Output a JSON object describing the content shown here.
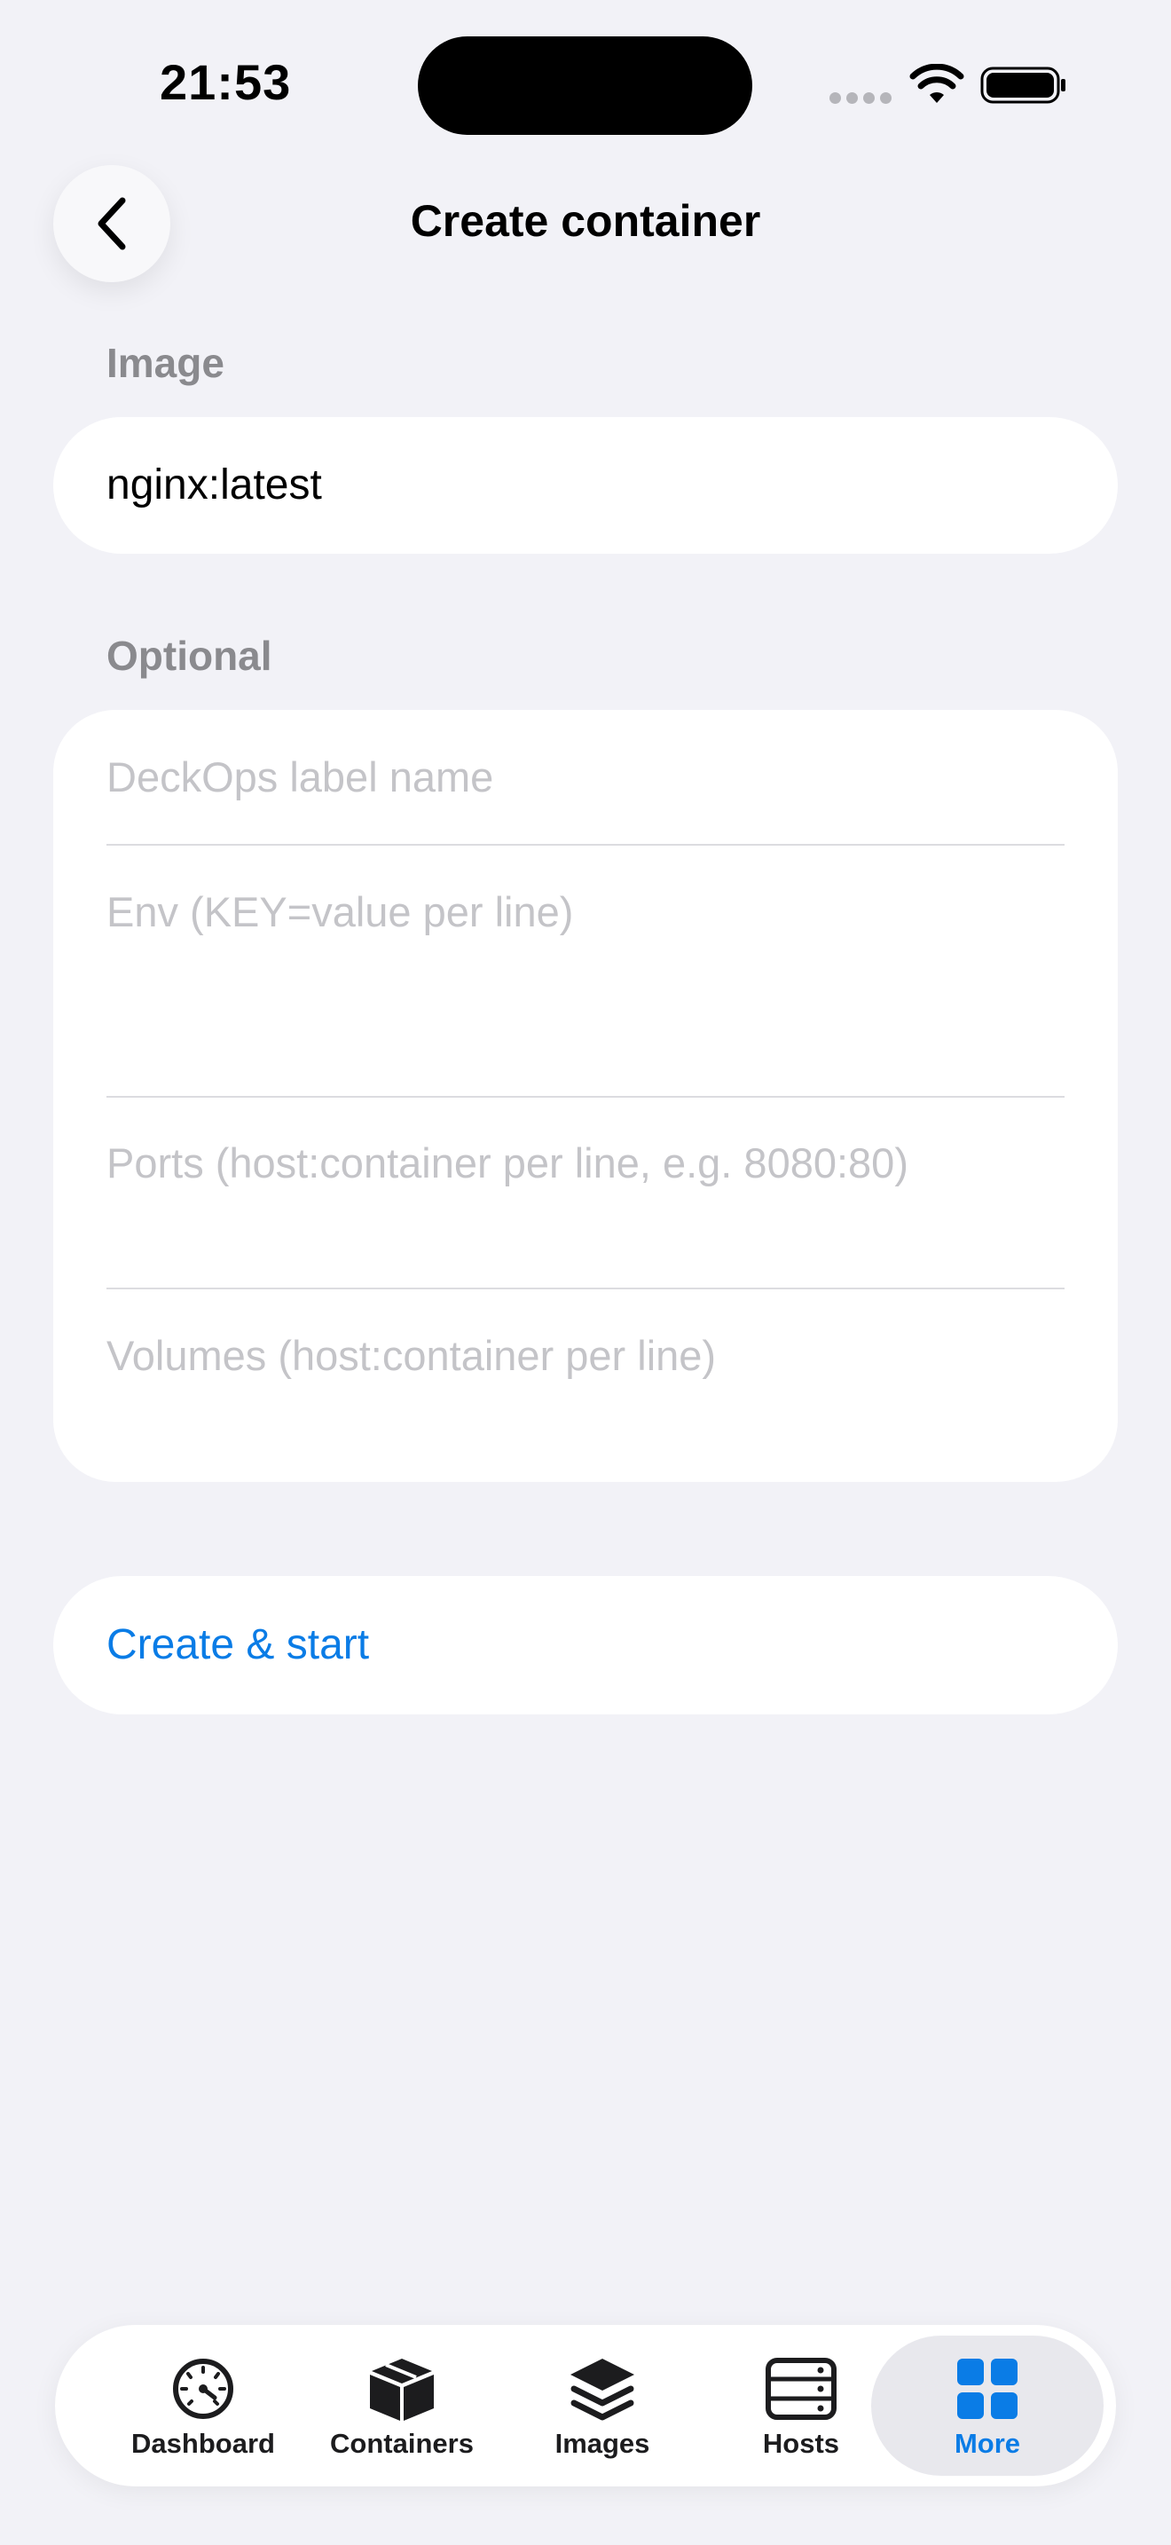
{
  "status_bar": {
    "time": "21:53"
  },
  "nav": {
    "title": "Create container",
    "back_icon": "chevron-left-icon"
  },
  "image_section": {
    "header": "Image",
    "value": "nginx:latest"
  },
  "optional_section": {
    "header": "Optional",
    "label_placeholder": "DeckOps label name",
    "env_placeholder": "Env (KEY=value per line)",
    "ports_placeholder": "Ports (host:container per line, e.g. 8080:80)",
    "volumes_placeholder": "Volumes (host:container per line)"
  },
  "actions": {
    "create_start": "Create & start"
  },
  "tab_bar": {
    "tabs": [
      {
        "label": "Dashboard",
        "icon": "gauge-icon",
        "active": false
      },
      {
        "label": "Containers",
        "icon": "box-icon",
        "active": false
      },
      {
        "label": "Images",
        "icon": "layers-icon",
        "active": false
      },
      {
        "label": "Hosts",
        "icon": "server-icon",
        "active": false
      },
      {
        "label": "More",
        "icon": "grid-icon",
        "active": true
      }
    ]
  },
  "colors": {
    "accent": "#0A7CE6",
    "background": "#F2F2F7",
    "placeholder": "#C4C4C8",
    "section_header": "#8A8A8E"
  }
}
